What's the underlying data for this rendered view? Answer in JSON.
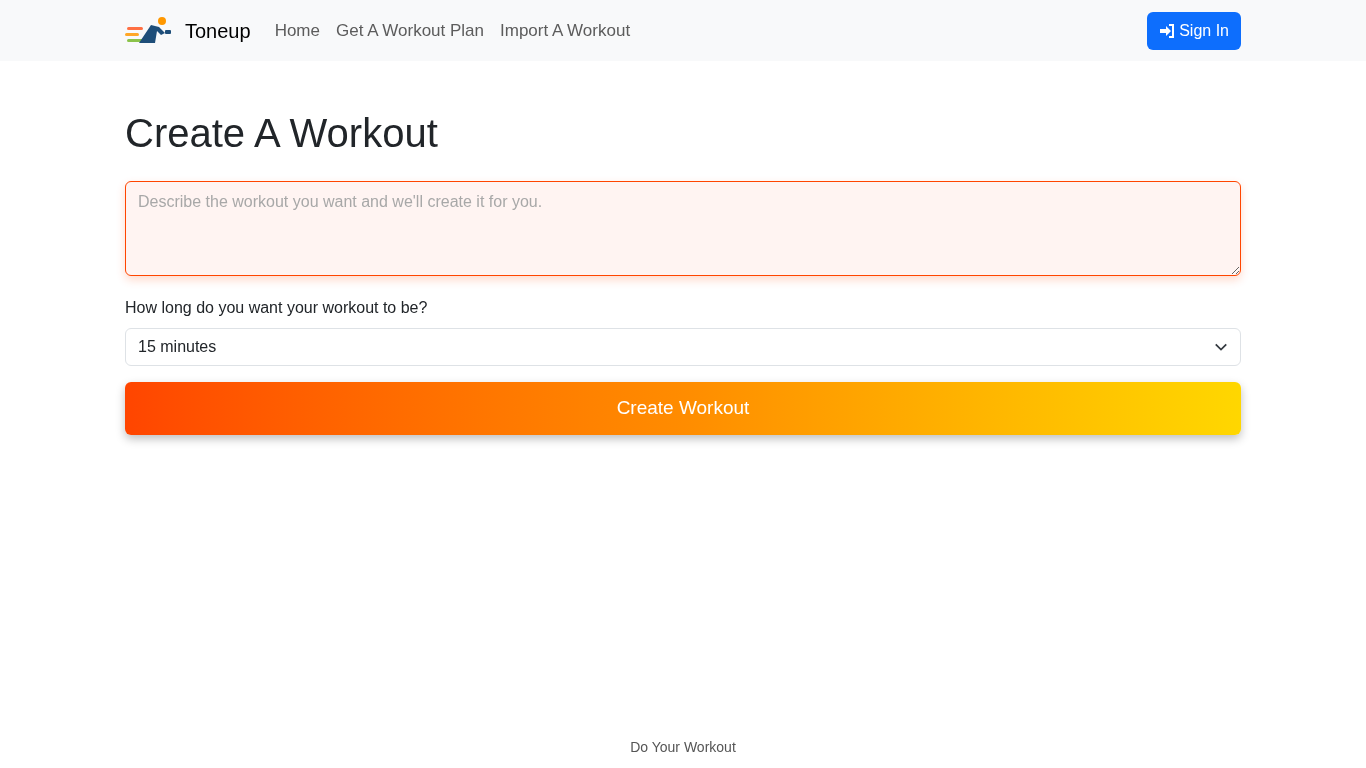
{
  "navbar": {
    "brand": "Toneup",
    "links": [
      {
        "label": "Home"
      },
      {
        "label": "Get A Workout Plan"
      },
      {
        "label": "Import A Workout"
      }
    ],
    "sign_in": "Sign In"
  },
  "heading": "Create A Workout",
  "description_field": {
    "placeholder": "Describe the workout you want and we'll create it for you."
  },
  "duration": {
    "label": "How long do you want your workout to be?",
    "value": "15 minutes"
  },
  "submit": "Create Workout",
  "footer": "Do Your Workout"
}
